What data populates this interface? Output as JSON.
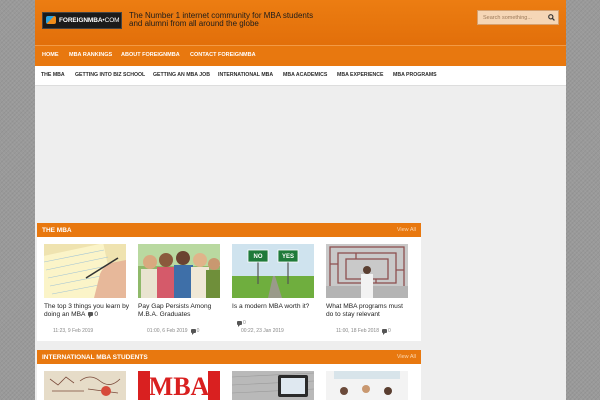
{
  "logo": {
    "text": "FOREIGNMBA",
    "suffix": "•COM"
  },
  "tagline": "The Number 1 internet community for MBA students and alumni from all around the globe",
  "search": {
    "placeholder": "Search something..."
  },
  "main_nav": [
    "HOME",
    "MBA RANKINGS",
    "ABOUT FOREIGNMBA",
    "CONTACT FOREIGNMBA"
  ],
  "sub_nav": [
    "THE MBA",
    "GETTING INTO BIZ SCHOOL",
    "GETTING AN MBA JOB",
    "INTERNATIONAL MBA",
    "MBA ACADEMICS",
    "MBA EXPERIENCE",
    "MBA PROGRAMS"
  ],
  "sections": [
    {
      "title": "THE MBA",
      "view_all": "View All",
      "posts": [
        {
          "title": "The top 3 things you learn by doing an MBA",
          "comments": "0",
          "date": "11:23, 9 Feb 2019"
        },
        {
          "title": "Pay Gap Persists Among M.B.A. Graduates",
          "comments": "0",
          "date": "01:00, 6 Feb 2019"
        },
        {
          "title": "Is a modern MBA worth it?",
          "comments": "0",
          "date": "00:22, 23 Jan 2019"
        },
        {
          "title": "What MBA programs must do to stay relevant",
          "comments": "0",
          "date": "11:00, 18 Feb 2018"
        }
      ]
    },
    {
      "title": "INTERNATIONAL MBA STUDENTS",
      "view_all": "View All"
    }
  ],
  "thumb_labels": {
    "no": "NO",
    "yes": "YES",
    "mba": "MBA"
  },
  "colors": {
    "accent": "#e8780f",
    "header": "#ec7d12",
    "background": "#eeeeee"
  }
}
